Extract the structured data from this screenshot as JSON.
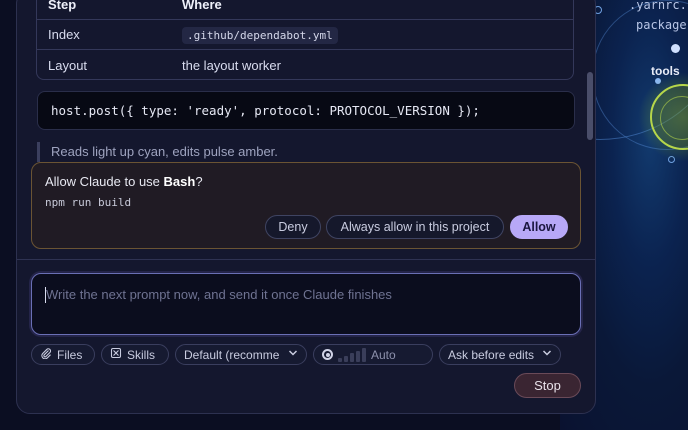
{
  "table": {
    "headers": {
      "step": "Step",
      "where": "Where"
    },
    "rows": [
      {
        "step": "Index",
        "where": ".github/dependabot.yml",
        "where_is_code": true
      },
      {
        "step": "Layout",
        "where": "the layout worker",
        "where_is_code": false
      }
    ]
  },
  "code_line": "host.post({ type: 'ready', protocol: PROTOCOL_VERSION });",
  "quote_text": "Reads light up cyan, edits pulse amber.",
  "permission": {
    "title_prefix": "Allow Claude to use ",
    "tool": "Bash",
    "title_suffix": "?",
    "command": "npm run build",
    "deny_label": "Deny",
    "always_label": "Always allow in this project",
    "allow_label": "Allow"
  },
  "prompt": {
    "placeholder": "Write the next prompt now, and send it once Claude finishes"
  },
  "toolbar": {
    "files_label": "Files",
    "skills_label": "Skills",
    "model_label": "Default (recomme",
    "effort_label": "Auto",
    "mode_label": "Ask before edits"
  },
  "stop_label": "Stop",
  "canvas": {
    "file_labels": [
      ".yarnrc.",
      "package.",
      "tools"
    ]
  },
  "colors": {
    "accent_allow": "#b7a8f7",
    "permission_border": "#6b5433",
    "prompt_border": "#6a6fb5",
    "canvas_ring": "#b6d64a"
  }
}
